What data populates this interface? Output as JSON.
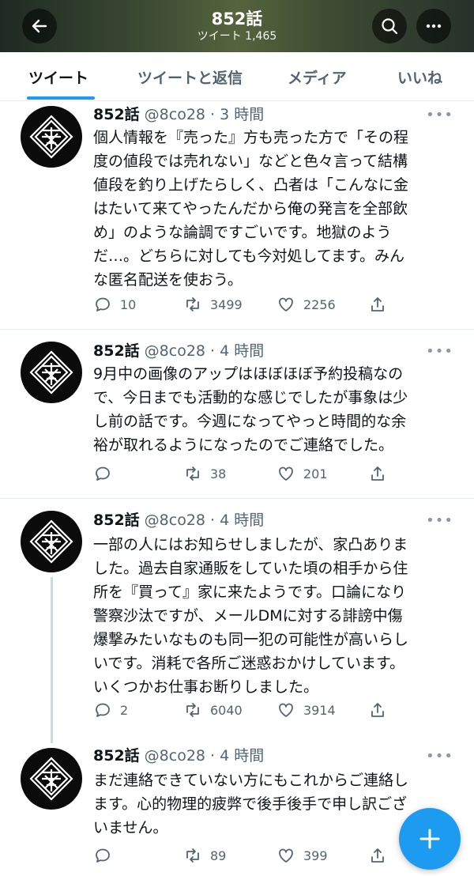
{
  "header": {
    "name": "852話",
    "tweet_count": "ツイート 1,465",
    "icons": [
      "arrow-left-icon",
      "search-icon",
      "more-horizontal-icon"
    ]
  },
  "tabs": [
    {
      "label": "ツイート",
      "active": true
    },
    {
      "label": "ツイートと返信",
      "active": false
    },
    {
      "label": "メディア",
      "active": false
    },
    {
      "label": "いいね",
      "active": false
    }
  ],
  "tweets": [
    {
      "name": "852話",
      "handle_time": "@8co28 · 3 時間",
      "lines": [
        "個人情報を『売った』方も売った方で「その程",
        "度の値段では売れない」などと色々言って結構",
        "値段を釣り上げたらしく、凸者は「こんなに金",
        "はたいて来てやったんだから俺の発言を全部飲",
        "め」のような論調ですごいです。地獄のよう",
        "だ…。どちらに対しても今対処してます。みん",
        "な匿名配送を使おう。"
      ],
      "replies": "10",
      "retweets": "3499",
      "likes": "2256"
    },
    {
      "name": "852話",
      "handle_time": "@8co28 · 4 時間",
      "lines": [
        "9月中の画像のアップはほぼほぼ予約投稿なの",
        "で、今日までも活動的な感じでしたが事象は少",
        "し前の話です。今週になってやっと時間的な余",
        "裕が取れるようになったのでご連絡でした。"
      ],
      "replies": "",
      "retweets": "38",
      "likes": "201"
    },
    {
      "name": "852話",
      "handle_time": "@8co28 · 4 時間",
      "lines": [
        "一部の人にはお知らせしましたが、家凸ありま",
        "した。過去自家通販をしていた頃の相手から住",
        "所を『買って』家に来たようです。口論になり",
        "警察沙汰ですが、メールDMに対する誹謗中傷",
        "爆撃みたいなものも同一犯の可能性が高いらし",
        "いです。消耗で各所ご迷惑おかけしています。",
        "いくつかお仕事お断りしました。"
      ],
      "replies": "2",
      "retweets": "6040",
      "likes": "3914"
    },
    {
      "name": "852話",
      "handle_time": "@8co28 · 4 時間",
      "lines": [
        "まだ連絡できていない方にもこれからご連絡し",
        "ます。心的物理的疲弊で後手後手で申し訳ござ",
        "いません。"
      ],
      "replies": "",
      "retweets": "89",
      "likes": "399"
    }
  ],
  "fab": {
    "label": "+",
    "icon": "compose-plus-icon"
  },
  "colors": {
    "accent": "#1d9bf0",
    "text": "#0f1419",
    "muted": "#536471",
    "border": "#e6ecf0"
  }
}
